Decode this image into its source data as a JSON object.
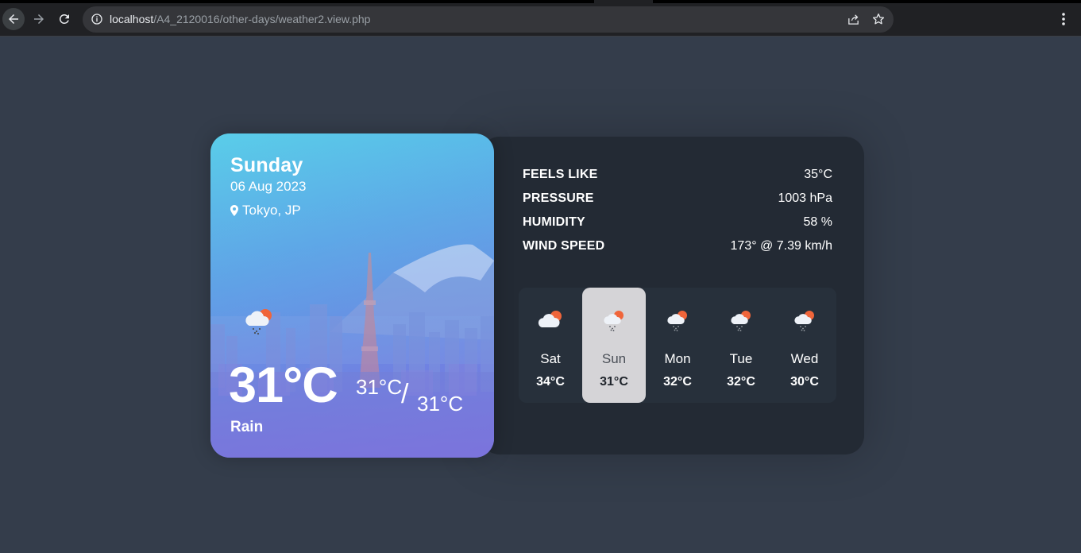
{
  "browser": {
    "url_host": "localhost",
    "url_path": "/A4_2120016/other-days/weather2.view.php",
    "icons": {
      "back": "arrow-left-icon",
      "forward": "arrow-right-icon",
      "reload": "reload-icon",
      "info": "info-icon",
      "share": "share-icon",
      "bookmark": "star-icon",
      "menu": "kebab-menu-icon"
    }
  },
  "current": {
    "day": "Sunday",
    "date": "06 Aug 2023",
    "location": "Tokyo, JP",
    "temp": "31°C",
    "temp_high": "31°C",
    "slash": "/",
    "temp_low": "31°C",
    "description": "Rain",
    "icon": "rain-cloud-sun-icon"
  },
  "details": [
    {
      "label": "FEELS LIKE",
      "value": "35°C"
    },
    {
      "label": "PRESSURE",
      "value": "1003 hPa"
    },
    {
      "label": "HUMIDITY",
      "value": "58 %"
    },
    {
      "label": "WIND SPEED",
      "value": "173° @ 7.39 km/h"
    }
  ],
  "week": [
    {
      "day": "Sat",
      "temp": "34°C",
      "icon": "cloud-sun-icon",
      "active": false
    },
    {
      "day": "Sun",
      "temp": "31°C",
      "icon": "rain-cloud-sun-icon",
      "active": true
    },
    {
      "day": "Mon",
      "temp": "32°C",
      "icon": "rain-cloud-sun-icon",
      "active": false
    },
    {
      "day": "Tue",
      "temp": "32°C",
      "icon": "rain-cloud-sun-icon",
      "active": false
    },
    {
      "day": "Wed",
      "temp": "30°C",
      "icon": "rain-cloud-sun-icon",
      "active": false
    }
  ],
  "colors": {
    "page_bg": "#343d4b",
    "panel_bg": "#232a34",
    "active_day_bg": "#d5d4d7",
    "sun": "#f0653a"
  }
}
